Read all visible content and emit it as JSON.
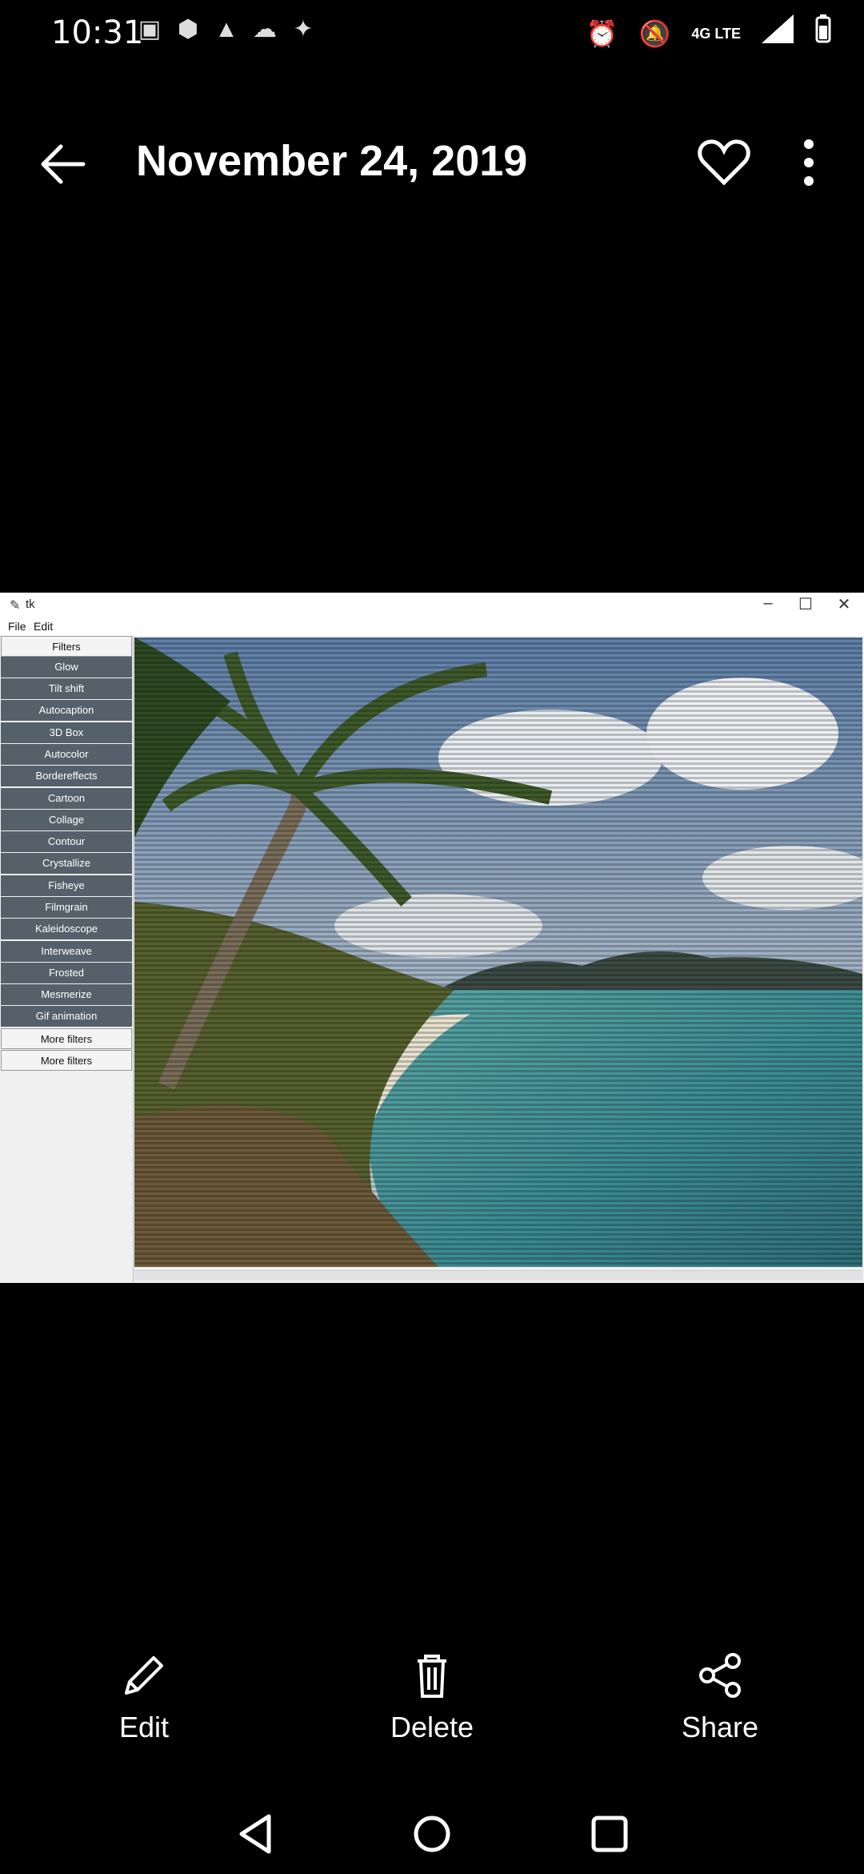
{
  "status_bar": {
    "time": "10:31",
    "left_icons": [
      "notification-icon",
      "vpn-icon",
      "image-icon",
      "cloud-icon",
      "bike-icon"
    ],
    "network": "4G LTE"
  },
  "app_bar": {
    "title": "November 24, 2019"
  },
  "photo": {
    "window_title": "tk",
    "menu": [
      "File",
      "Edit"
    ],
    "sidebar_header": "Filters",
    "filters": [
      "Glow",
      "Tilt shift",
      "Autocaption",
      "3D Box",
      "Autocolor",
      "Bordereffects",
      "Cartoon",
      "Collage",
      "Contour",
      "Crystallize",
      "Fisheye",
      "Filmgrain",
      "Kaleidoscope",
      "Interweave",
      "Frosted",
      "Mesmerize",
      "Gif animation"
    ],
    "more_buttons": [
      "More filters",
      "More filters"
    ]
  },
  "actions": {
    "edit": "Edit",
    "delete": "Delete",
    "share": "Share"
  }
}
